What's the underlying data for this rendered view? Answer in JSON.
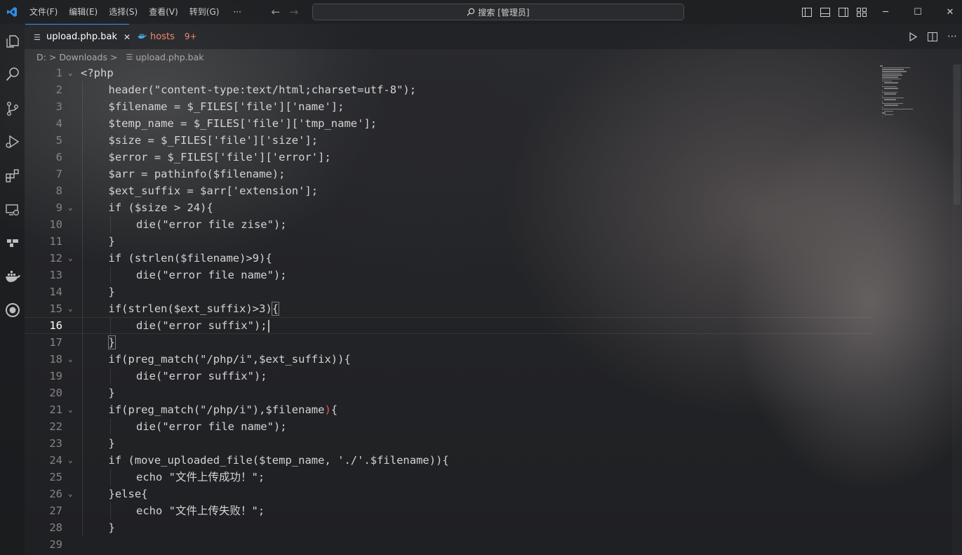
{
  "app": {
    "menu": [
      "文件(F)",
      "编辑(E)",
      "选择(S)",
      "查看(V)",
      "转到(G)"
    ],
    "more": "···",
    "search_text": "搜索 [管理员]"
  },
  "tabs": [
    {
      "label": "upload.php.bak",
      "close": "✕",
      "active": true
    },
    {
      "label": "hosts",
      "badge": "9+",
      "active": false
    }
  ],
  "breadcrumb": {
    "drive": "D:",
    "folder": "Downloads",
    "file": "upload.php.bak",
    "sep": ">"
  },
  "editor": {
    "current_line": 16,
    "lines": [
      {
        "n": "1",
        "fold": true,
        "indent": 0,
        "text": "<?php"
      },
      {
        "n": "2",
        "fold": false,
        "indent": 1,
        "text": "header(\"content-type:text/html;charset=utf-8\");"
      },
      {
        "n": "3",
        "fold": false,
        "indent": 1,
        "text": "$filename = $_FILES['file']['name'];"
      },
      {
        "n": "4",
        "fold": false,
        "indent": 1,
        "text": "$temp_name = $_FILES['file']['tmp_name'];"
      },
      {
        "n": "5",
        "fold": false,
        "indent": 1,
        "text": "$size = $_FILES['file']['size'];"
      },
      {
        "n": "6",
        "fold": false,
        "indent": 1,
        "text": "$error = $_FILES['file']['error'];"
      },
      {
        "n": "7",
        "fold": false,
        "indent": 1,
        "text": "$arr = pathinfo($filename);"
      },
      {
        "n": "8",
        "fold": false,
        "indent": 1,
        "text": "$ext_suffix = $arr['extension'];"
      },
      {
        "n": "9",
        "fold": true,
        "indent": 1,
        "text": "if ($size > 24){"
      },
      {
        "n": "10",
        "fold": false,
        "indent": 2,
        "text": "die(\"error file zise\");"
      },
      {
        "n": "11",
        "fold": false,
        "indent": 1,
        "text": "}"
      },
      {
        "n": "12",
        "fold": true,
        "indent": 1,
        "text": "if (strlen($filename)>9){"
      },
      {
        "n": "13",
        "fold": false,
        "indent": 2,
        "text": "die(\"error file name\");"
      },
      {
        "n": "14",
        "fold": false,
        "indent": 1,
        "text": "}"
      },
      {
        "n": "15",
        "fold": true,
        "indent": 1,
        "text": "if(strlen($ext_suffix)>3)",
        "tail_box": "{"
      },
      {
        "n": "16",
        "fold": false,
        "indent": 2,
        "text": "die(\"error suffix\");",
        "caret": true
      },
      {
        "n": "17",
        "fold": false,
        "indent": 1,
        "text": "",
        "tail_box": "}"
      },
      {
        "n": "18",
        "fold": true,
        "indent": 1,
        "text": "if(preg_match(\"/php/i\",$ext_suffix)){"
      },
      {
        "n": "19",
        "fold": false,
        "indent": 2,
        "text": "die(\"error suffix\");"
      },
      {
        "n": "20",
        "fold": false,
        "indent": 1,
        "text": "}"
      },
      {
        "n": "21",
        "fold": true,
        "indent": 1,
        "text": "if(preg_match(\"/php/i\"),$filename",
        "tail_err": ")",
        "tail": "{"
      },
      {
        "n": "22",
        "fold": false,
        "indent": 2,
        "text": "die(\"error file name\");"
      },
      {
        "n": "23",
        "fold": false,
        "indent": 1,
        "text": "}"
      },
      {
        "n": "24",
        "fold": true,
        "indent": 1,
        "text": "if (move_uploaded_file($temp_name, './'.$filename)){"
      },
      {
        "n": "25",
        "fold": false,
        "indent": 2,
        "text": "echo \"文件上传成功！\";"
      },
      {
        "n": "26",
        "fold": true,
        "indent": 1,
        "text": "}else{"
      },
      {
        "n": "27",
        "fold": false,
        "indent": 2,
        "text": "echo \"文件上传失败！\";"
      },
      {
        "n": "28",
        "fold": false,
        "indent": 1,
        "text": "}"
      },
      {
        "n": "29",
        "fold": false,
        "indent": 0,
        "text": ""
      }
    ]
  },
  "icons": {
    "app": "vscode-logo-icon",
    "activity": [
      "explorer-icon",
      "search-icon",
      "source-control-icon",
      "run-debug-icon",
      "extensions-icon",
      "remote-explorer-icon",
      "git-graph-icon",
      "docker-icon",
      "github-icon"
    ]
  },
  "colors": {
    "accent": "#3794ff",
    "tab_warning": "#f48771",
    "error_bracket": "#e55757"
  }
}
